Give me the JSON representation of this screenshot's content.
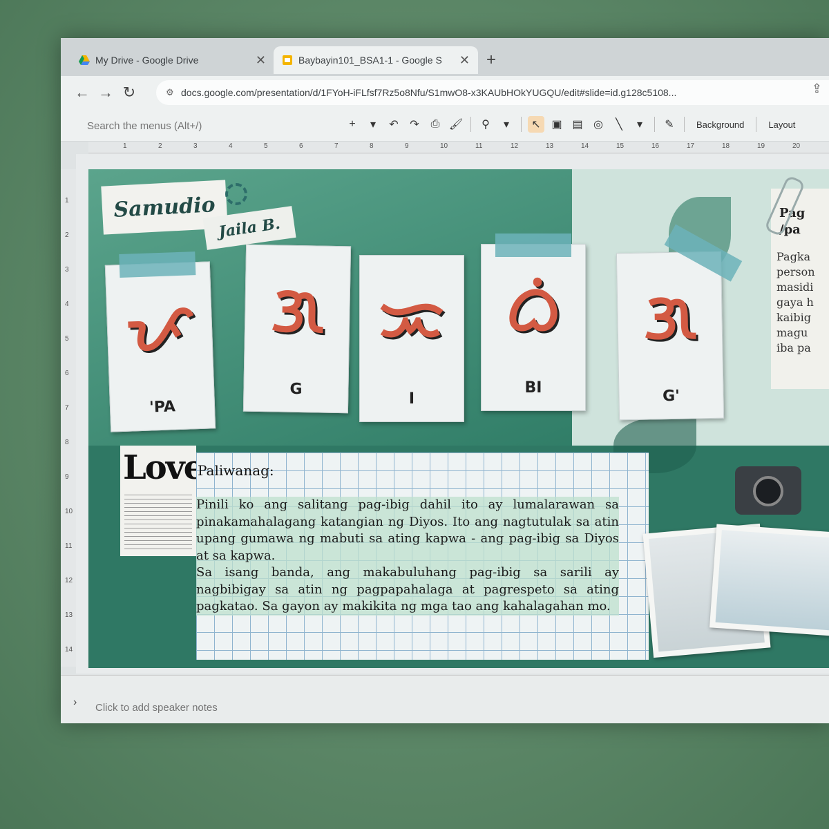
{
  "browser": {
    "tabs": [
      {
        "title": "My Drive - Google Drive",
        "active": false,
        "favicon": "drive-icon"
      },
      {
        "title": "Baybayin101_BSA1-1 - Google S",
        "active": true,
        "favicon": "slides-icon"
      }
    ],
    "new_tab_label": "+",
    "url": "docs.google.com/presentation/d/1FYoH-iFLfsf7Rz5o8Nfu/S1mwO8-x3KAUbHOkYUGQU/edit#slide=id.g128c5108..."
  },
  "toolbar": {
    "search_placeholder": "Search the menus (Alt+/)",
    "background_label": "Background",
    "layout_label": "Layout"
  },
  "ruler": [
    "1",
    "2",
    "3",
    "4",
    "5",
    "6",
    "7",
    "8",
    "9",
    "10",
    "11",
    "12",
    "13",
    "14",
    "15",
    "16",
    "17",
    "18",
    "19",
    "20"
  ],
  "vruler": [
    "1",
    "2",
    "3",
    "4",
    "5",
    "6",
    "7",
    "8",
    "9",
    "10",
    "11",
    "12",
    "13",
    "14"
  ],
  "slide": {
    "name_tag": "Samudio",
    "name_sub": "Jaila B.",
    "cards": [
      {
        "glyph": "ᜉ",
        "syllable": "'PA"
      },
      {
        "glyph": "ᜄ",
        "syllable": "G"
      },
      {
        "glyph": "ᜁ",
        "syllable": "I"
      },
      {
        "glyph": "ᜊᜒ",
        "syllable": "BI"
      },
      {
        "glyph": "ᜄ",
        "syllable": "G'"
      }
    ],
    "newspaper_word": "Love",
    "paliwanag_header": "Paliwanag:",
    "paragraph1": "Pinili ko ang salitang pag-ibig dahil ito ay lumalarawan sa pinakamahalagang katangian ng Diyos. Ito ang nagtutulak sa atin upang gumawa ng mabuti sa ating kapwa - ang pag-ibig sa Diyos at sa kapwa.",
    "paragraph2": "Sa isang banda, ang makabuluhang pag-ibig sa sarili ay nagbibigay sa atin ng pagpapahalaga at pagrespeto sa ating pagkatao. Sa gayon ay makikita ng mga tao ang kahalagahan mo.",
    "side_note_title": "Pag\n/pa",
    "side_note_body": "Pagka\nperson\nmasidi\ngaya h\nkaibig\nmagu\niba pa"
  },
  "notes": {
    "placeholder": "Click to add speaker notes",
    "toggle": "›"
  },
  "colors": {
    "accent": "#d35a43",
    "tape": "#6cb3ba",
    "slide_bg": "#3f8f78"
  }
}
